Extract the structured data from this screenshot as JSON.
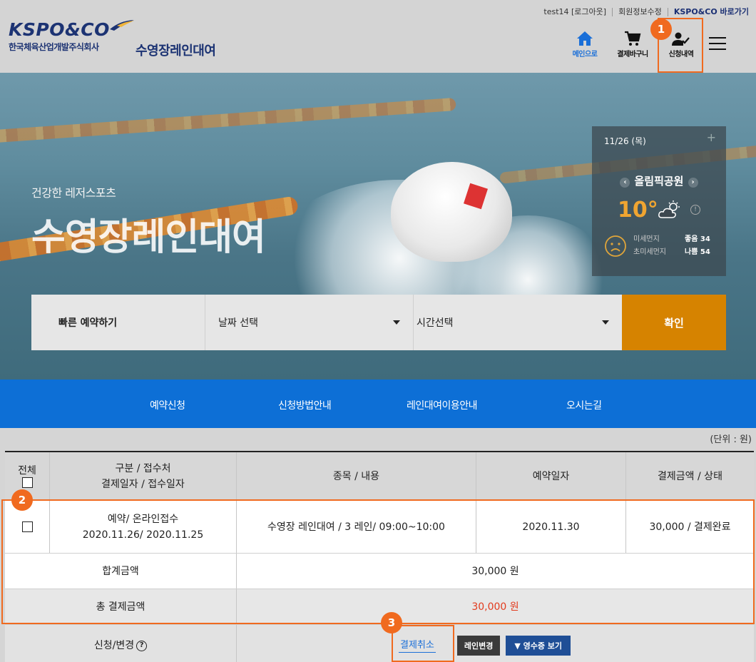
{
  "header": {
    "top_links": [
      "test14 [로그아웃]",
      "회원정보수정",
      "KSPO&CO 바로가기"
    ],
    "logo_text": "KSPO&CO",
    "logo_sub": "한국체육산업개발주식회사",
    "site_title": "수영장레인대여",
    "icons": [
      {
        "label": "메인으로",
        "icon": "home-icon"
      },
      {
        "label": "결제바구니",
        "icon": "cart-icon"
      },
      {
        "label": "신청내역",
        "icon": "user-check-icon"
      }
    ],
    "menu_icon": "hamburger-icon"
  },
  "hero": {
    "subtitle": "건강한 레저스포츠",
    "title": "수영장레인대여",
    "weather": {
      "date": "11/26 (목)",
      "plus": "+",
      "location": "올림픽공원",
      "temp": "10°",
      "fine_dust_label": "미세먼지",
      "fine_dust_value": "좋음 34",
      "ultra_dust_label": "초미세먼지",
      "ultra_dust_value": "나쁨 54"
    },
    "quick": {
      "label": "빠른 예약하기",
      "date_select": "날짜 선택",
      "time_select": "시간선택",
      "confirm": "확인"
    }
  },
  "nav": [
    "예약신청",
    "신청방법안내",
    "레인대여이용안내",
    "오시는길"
  ],
  "table": {
    "unit": "(단위 : 원)",
    "headers": {
      "all": "전체",
      "category_1": "구분 / 접수처",
      "category_2": "결제일자 / 접수일자",
      "item": "종목 / 내용",
      "reserve_date": "예약일자",
      "amount_status": "결제금액 / 상태"
    },
    "row": {
      "category_1": "예약/ 온라인접수",
      "category_2": "2020.11.26/ 2020.11.25",
      "item": "수영장 레인대여 / 3 레인/ 09:00~10:00",
      "reserve_date": "2020.11.30",
      "amount_status": "30,000 / 결제완료"
    },
    "sum_label": "합계금액",
    "sum_value": "30,000 원",
    "total_label": "총 결제금액",
    "total_value": "30,000 원",
    "action_label": "신청/변경",
    "action_help": "?",
    "buttons": {
      "cancel": "결제취소",
      "lane_change": "레인변경",
      "receipt": "▼ 영수증 보기"
    }
  },
  "annotations": [
    "1",
    "2",
    "3"
  ],
  "colors": {
    "brand": "#1c3373",
    "nav": "#0d6fd6",
    "confirm": "#d68300",
    "highlight": "#f06a1f",
    "total": "#e23b1e"
  }
}
